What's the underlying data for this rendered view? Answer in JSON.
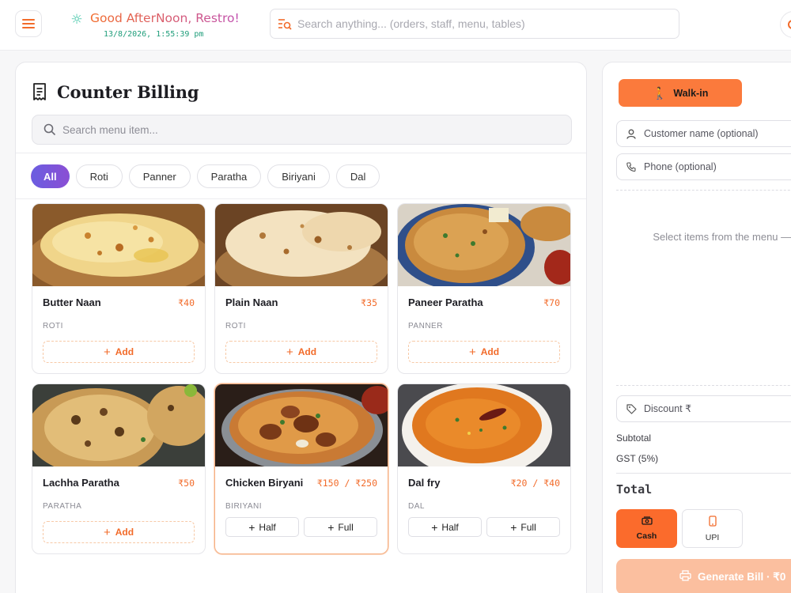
{
  "header": {
    "greeting": "Good AfterNoon, Restro!",
    "datetime": "13/8/2026, 1:55:39 pm",
    "search_placeholder": "Search anything... (orders, staff, menu, tables)"
  },
  "main": {
    "title": "Counter Billing",
    "search_placeholder": "Search menu item...",
    "categories": [
      "All",
      "Roti",
      "Panner",
      "Paratha",
      "Biriyani",
      "Dal"
    ],
    "active_category": "All",
    "items": [
      {
        "name": "Butter Naan",
        "price": "₹40",
        "category": "ROTI",
        "add_label": "Add"
      },
      {
        "name": "Plain Naan",
        "price": "₹35",
        "category": "ROTI",
        "add_label": "Add"
      },
      {
        "name": "Paneer Paratha",
        "price": "₹70",
        "category": "PANNER",
        "add_label": "Add"
      },
      {
        "name": "Lachha Paratha",
        "price": "₹50",
        "category": "PARATHA",
        "add_label": "Add"
      },
      {
        "name": "Chicken Biryani",
        "price": "₹150 / ₹250",
        "category": "BIRIYANI",
        "half_label": "Half",
        "full_label": "Full"
      },
      {
        "name": "Dal fry",
        "price": "₹20 / ₹40",
        "category": "DAL",
        "half_label": "Half",
        "full_label": "Full"
      }
    ]
  },
  "side": {
    "tab_walkin": "Walk-in",
    "customer_placeholder": "Customer name (optional)",
    "phone_placeholder": "Phone (optional)",
    "empty_message": "Select items from the menu — your here",
    "discount_placeholder": "Discount ₹",
    "subtotal_label": "Subtotal",
    "gst_label": "GST (5%)",
    "total_label": "Total",
    "pay_cash": "Cash",
    "pay_upi": "UPI",
    "generate_label": "Generate Bill · ₹0"
  },
  "colors": {
    "accent": "#f26b2a",
    "active_chip_start": "#6b5de0",
    "active_chip_end": "#8a4fd4"
  }
}
